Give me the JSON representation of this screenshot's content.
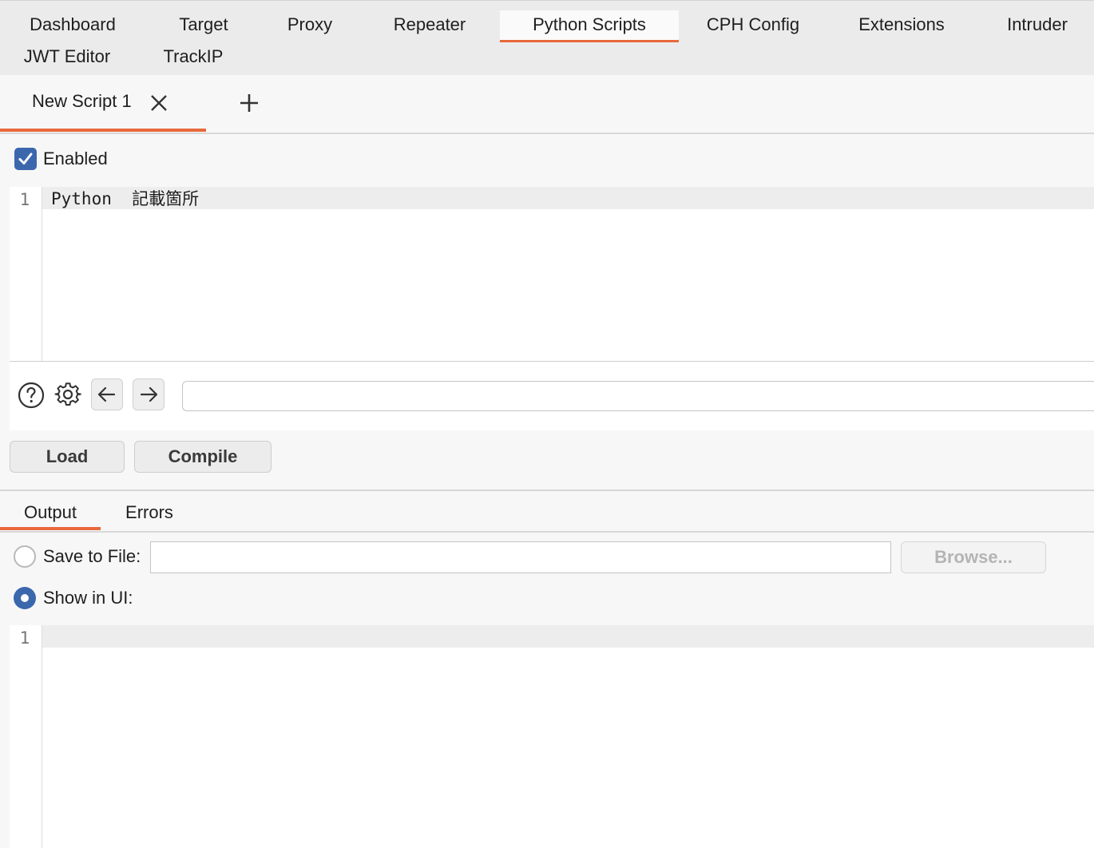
{
  "main_tabs": [
    {
      "label": "Dashboard"
    },
    {
      "label": "Target"
    },
    {
      "label": "Proxy"
    },
    {
      "label": "Repeater"
    },
    {
      "label": "Python Scripts",
      "active": true
    },
    {
      "label": "CPH Config"
    },
    {
      "label": "Extensions"
    },
    {
      "label": "Intruder"
    },
    {
      "label": "JWT Editor"
    },
    {
      "label": "TrackIP"
    }
  ],
  "script_tabs": {
    "active_label": "New Script 1",
    "close_icon": "close-icon",
    "add_icon": "plus-icon"
  },
  "enabled": {
    "label": "Enabled",
    "checked": true
  },
  "script_editor": {
    "line_numbers": [
      "1"
    ],
    "code_line_1": "Python  記載箇所"
  },
  "toolbar": {
    "help_icon": "help-icon",
    "settings_icon": "gear-icon",
    "prev_icon": "arrow-left-icon",
    "next_icon": "arrow-right-icon",
    "search_value": "",
    "load_label": "Load",
    "compile_label": "Compile"
  },
  "output_tabs": [
    {
      "label": "Output",
      "active": true
    },
    {
      "label": "Errors"
    }
  ],
  "output_options": {
    "save_to_file_label": "Save to File:",
    "save_to_file_selected": false,
    "save_path_value": "",
    "browse_label": "Browse...",
    "show_in_ui_label": "Show in UI:",
    "show_in_ui_selected": true
  },
  "output_editor": {
    "line_numbers": [
      "1"
    ],
    "code_line_1": ""
  },
  "colors": {
    "accent": "#e8683c",
    "checkbox_blue": "#3b67ad"
  }
}
